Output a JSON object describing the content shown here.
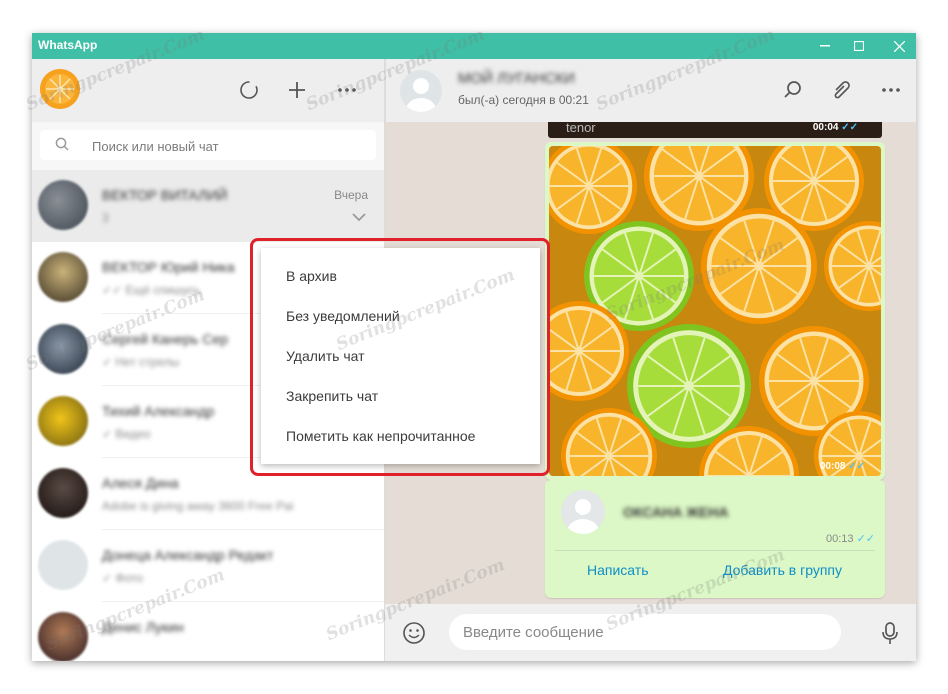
{
  "window": {
    "title": "WhatsApp",
    "minimize": "—",
    "maximize": "☐",
    "close": "✕"
  },
  "colors": {
    "titlebar": "#3fbfa5",
    "header_bg": "#eeeeee",
    "chat_bg": "#e5ddd5",
    "bubble_out": "#dcf8c6",
    "menu_highlight": "#e0212b",
    "link": "#0f8ec7"
  },
  "left": {
    "header_icons": [
      "status-icon",
      "new-chat-icon",
      "menu-icon"
    ],
    "search": {
      "placeholder": "Поиск или новый чат",
      "value": ""
    },
    "chats": [
      {
        "name": "ВЕКТОР ВИТАЛИЙ",
        "snippet": "3",
        "time": "Вчера",
        "active": true
      },
      {
        "name": "ВЕКТОР Юрий Ника",
        "snippet": "✓✓ Ещё спишусь",
        "time": ""
      },
      {
        "name": "Сергей Канерь Сер",
        "snippet": "✓ Нет стрелы",
        "time": ""
      },
      {
        "name": "Тихий Александр",
        "snippet": "✓ Видео",
        "time": ""
      },
      {
        "name": "Алеся Дина",
        "snippet": "Adobe is giving away 3600 Free Pai",
        "time": ""
      },
      {
        "name": "Донеца Александр Редакт",
        "snippet": "✓ Фото",
        "time": ""
      },
      {
        "name": "Денис Лукин",
        "snippet": "",
        "time": ""
      }
    ]
  },
  "right": {
    "contact": {
      "name": "МОЙ ЛУГАНСКИ",
      "status": "был(-а) сегодня в 00:21"
    },
    "header_icons": [
      "search-icon",
      "attach-icon",
      "menu-icon"
    ],
    "gif": {
      "label": "tenor",
      "time": "00:04"
    },
    "image_msg": {
      "time": "00:08"
    },
    "contact_card": {
      "name": "ОКСАНА ЖЕНА",
      "time": "00:13",
      "write": "Написать",
      "add_to_group": "Добавить в группу"
    },
    "composer": {
      "placeholder": "Введите сообщение",
      "value": ""
    }
  },
  "context_menu": {
    "items": [
      "В архив",
      "Без уведомлений",
      "Удалить чат",
      "Закрепить чат",
      "Пометить как непрочитанное"
    ]
  },
  "watermark": "Soringpcrepair.Com"
}
